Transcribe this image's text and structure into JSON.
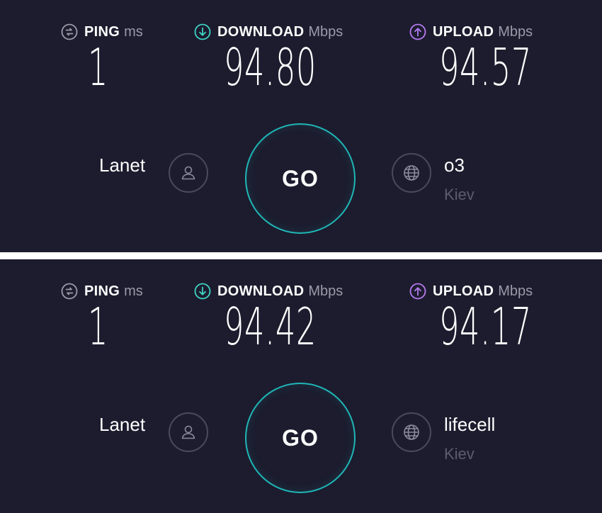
{
  "colors": {
    "background": "#1c1c2e",
    "ping_icon": "#9a9aaa",
    "download_accent": "#3fd3c3",
    "upload_accent": "#b57bf0",
    "go_ring": "#1fb6b6",
    "unit_text": "#9a9aaa",
    "location_text": "#5c5c70"
  },
  "panels": [
    {
      "ping": {
        "label": "PING",
        "unit": "ms",
        "value": "1",
        "icon": "ping-icon"
      },
      "download": {
        "label": "DOWNLOAD",
        "unit": "Mbps",
        "value": "94.80",
        "icon": "download-icon"
      },
      "upload": {
        "label": "UPLOAD",
        "unit": "Mbps",
        "value": "94.57",
        "icon": "upload-icon"
      },
      "isp": "Lanet",
      "go_label": "GO",
      "server": {
        "name": "o3",
        "location": "Kiev"
      }
    },
    {
      "ping": {
        "label": "PING",
        "unit": "ms",
        "value": "1",
        "icon": "ping-icon"
      },
      "download": {
        "label": "DOWNLOAD",
        "unit": "Mbps",
        "value": "94.42",
        "icon": "download-icon"
      },
      "upload": {
        "label": "UPLOAD",
        "unit": "Mbps",
        "value": "94.17",
        "icon": "upload-icon"
      },
      "isp": "Lanet",
      "go_label": "GO",
      "server": {
        "name": "lifecell",
        "location": "Kiev"
      }
    }
  ]
}
